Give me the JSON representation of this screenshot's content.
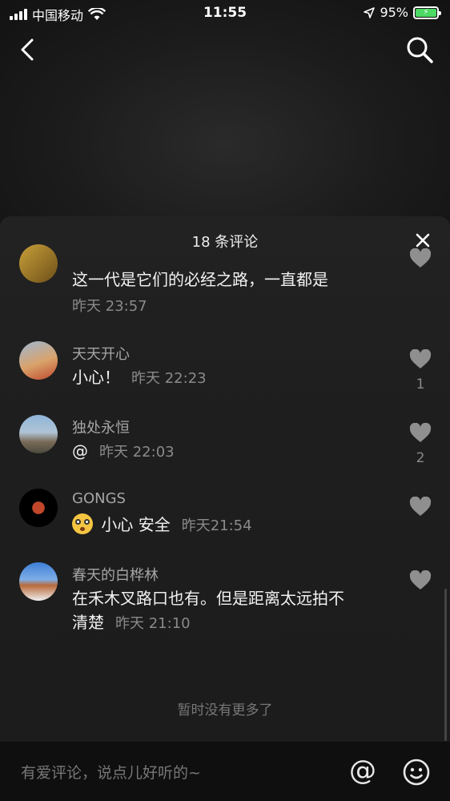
{
  "status_bar": {
    "carrier": "中国移动",
    "time": "11:55",
    "battery": "95%"
  },
  "sheet": {
    "title": "18 条评论",
    "no_more": "暂时没有更多了",
    "comments": [
      {
        "username": "",
        "text": "这一代是它们的必经之路，一直都是",
        "time": "昨天 23:57",
        "likes": ""
      },
      {
        "username": "天天开心",
        "text": "小心！",
        "time": "昨天 22:23",
        "likes": "1"
      },
      {
        "username": "独处永恒",
        "text": "@",
        "time": "昨天 22:03",
        "likes": "2"
      },
      {
        "username": "GONGS",
        "text": "小心 安全",
        "time": "昨天21:54",
        "likes": ""
      },
      {
        "username": "春天的白桦林",
        "text_line1": "在禾木叉路口也有。但是距离太远拍不",
        "text_line2": "清楚",
        "time": "昨天 21:10",
        "likes": ""
      }
    ]
  },
  "input": {
    "placeholder": "有爱评论，说点儿好听的~",
    "at_symbol": "@"
  },
  "icons": {
    "back": "chevron-left-icon",
    "search": "search-icon",
    "close": "close-icon",
    "heart": "heart-icon",
    "emoji": "emoji-icon",
    "location": "location-arrow-icon",
    "wifi": "wifi-icon",
    "signal": "signal-icon",
    "battery": "battery-icon"
  },
  "colors": {
    "accent_battery": "#4cd964",
    "sheet_bg": "#1e1e1e",
    "heart": "#8f8f8f"
  }
}
